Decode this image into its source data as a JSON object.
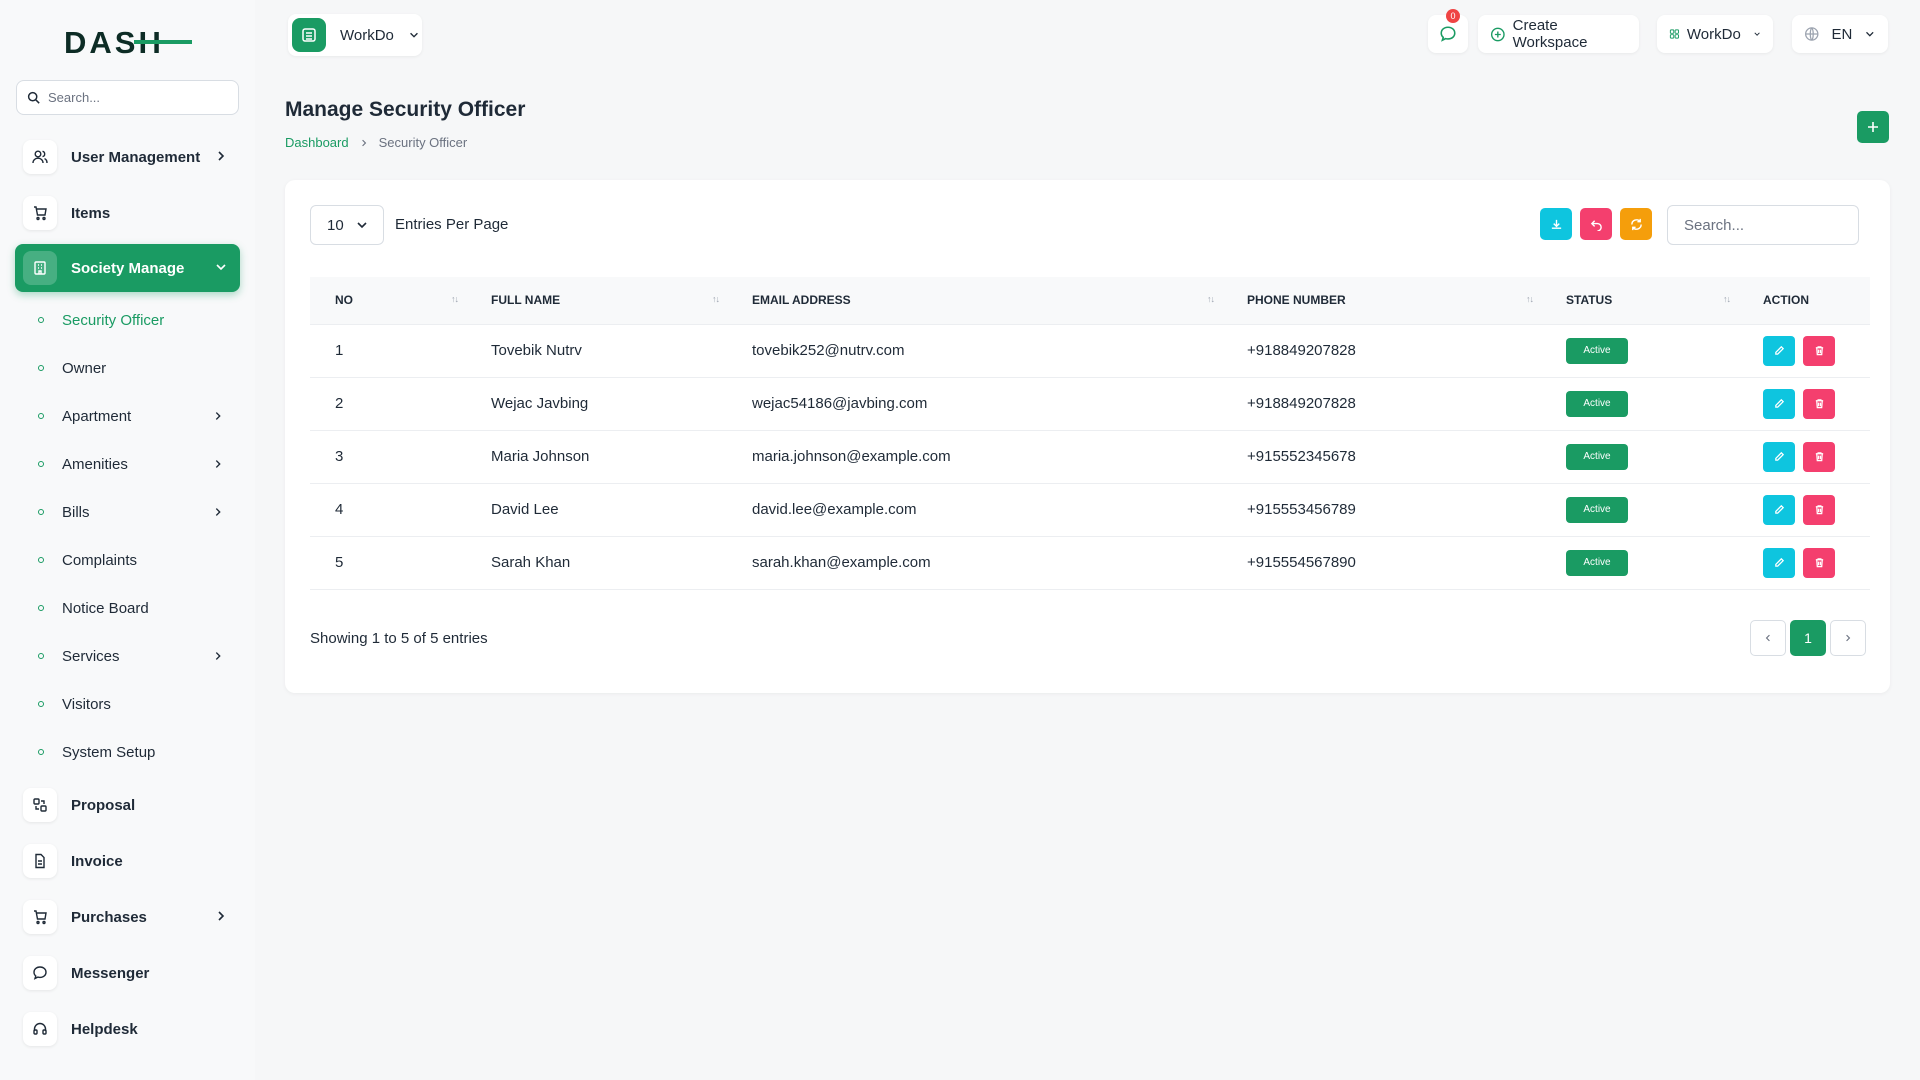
{
  "sidebar": {
    "logo_text": "DASH",
    "search_placeholder": "Search...",
    "items": [
      {
        "label": "User Management",
        "icon": "users-icon",
        "has_children": true
      },
      {
        "label": "Items",
        "icon": "cart-icon",
        "has_children": false
      },
      {
        "label": "Society Manage",
        "icon": "building-icon",
        "has_children": true,
        "active": true
      },
      {
        "label": "Proposal",
        "icon": "proposal-icon",
        "has_children": false
      },
      {
        "label": "Invoice",
        "icon": "invoice-icon",
        "has_children": false
      },
      {
        "label": "Purchases",
        "icon": "cart-icon",
        "has_children": true
      },
      {
        "label": "Messenger",
        "icon": "chat-icon",
        "has_children": false
      },
      {
        "label": "Helpdesk",
        "icon": "headset-icon",
        "has_children": false
      }
    ],
    "sub_items": [
      {
        "label": "Security Officer",
        "active": true
      },
      {
        "label": "Owner"
      },
      {
        "label": "Apartment",
        "has_children": true
      },
      {
        "label": "Amenities",
        "has_children": true
      },
      {
        "label": "Bills",
        "has_children": true
      },
      {
        "label": "Complaints"
      },
      {
        "label": "Notice Board"
      },
      {
        "label": "Services",
        "has_children": true
      },
      {
        "label": "Visitors"
      },
      {
        "label": "System Setup"
      }
    ]
  },
  "topbar": {
    "workspace": "WorkDo",
    "notification_count": "0",
    "create_workspace": "Create Workspace",
    "workspace_menu": "WorkDo",
    "language": "EN"
  },
  "page": {
    "title": "Manage Security Officer",
    "breadcrumb": [
      "Dashboard",
      "Security Officer"
    ]
  },
  "table": {
    "per_page": "10",
    "per_page_label": "Entries Per Page",
    "search_placeholder": "Search...",
    "columns": [
      "NO",
      "FULL NAME",
      "EMAIL ADDRESS",
      "PHONE NUMBER",
      "STATUS",
      "ACTION"
    ],
    "rows": [
      {
        "no": "1",
        "name": "Tovebik Nutrv",
        "email": "tovebik252@nutrv.com",
        "phone": "+918849207828",
        "status": "Active"
      },
      {
        "no": "2",
        "name": "Wejac Javbing",
        "email": "wejac54186@javbing.com",
        "phone": "+918849207828",
        "status": "Active"
      },
      {
        "no": "3",
        "name": "Maria Johnson",
        "email": "maria.johnson@example.com",
        "phone": "+915552345678",
        "status": "Active"
      },
      {
        "no": "4",
        "name": "David Lee",
        "email": "david.lee@example.com",
        "phone": "+915553456789",
        "status": "Active"
      },
      {
        "no": "5",
        "name": "Sarah Khan",
        "email": "sarah.khan@example.com",
        "phone": "+915554567890",
        "status": "Active"
      }
    ],
    "showing": "Showing 1 to 5 of 5 entries",
    "current_page": "1"
  },
  "colors": {
    "brand_green": "#1a9b63",
    "edit_cyan": "#0ec5df",
    "delete_pink": "#f43f6e",
    "refresh_orange": "#f59e0b"
  }
}
